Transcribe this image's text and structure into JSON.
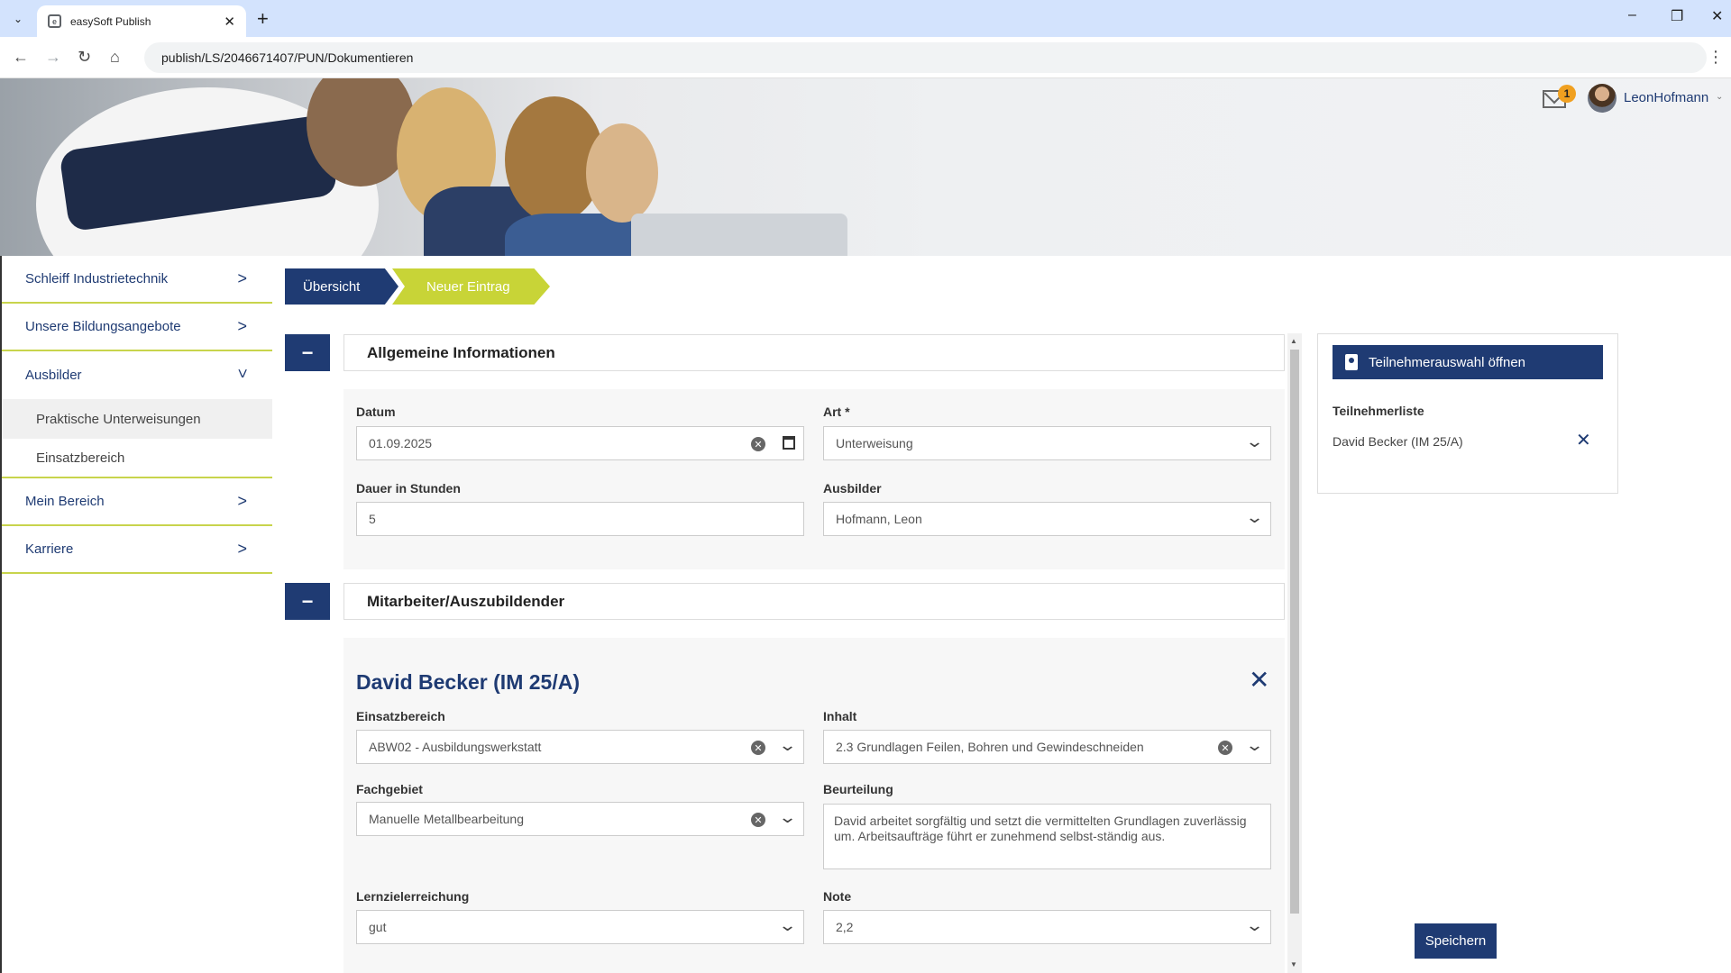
{
  "browser": {
    "tab_title": "easySoft Publish",
    "new_tab": "+",
    "url": "publish/LS/2046671407/PUN/Dokumentieren",
    "window_controls": [
      "–",
      "❐",
      "✕"
    ]
  },
  "header": {
    "notifications_count": "1",
    "user_name": "LeonHofmann"
  },
  "sidebar": {
    "items": [
      {
        "label": "Schleiff Industrietechnik"
      },
      {
        "label": "Unsere Bildungsangebote"
      },
      {
        "label": "Ausbilder"
      },
      {
        "label": "Mein Bereich"
      },
      {
        "label": "Karriere"
      }
    ],
    "sub_items": [
      {
        "label": "Praktische Unterweisungen"
      },
      {
        "label": "Einsatzbereich"
      }
    ]
  },
  "steps": {
    "step1": "Übersicht",
    "step2": "Neuer Eintrag"
  },
  "general": {
    "title": "Allgemeine Informationen",
    "collapse_label": "−",
    "datum_label": "Datum",
    "datum_value": "01.09.2025",
    "art_label": "Art *",
    "art_value": "Unterweisung",
    "dauer_label": "Dauer in Stunden",
    "dauer_value": "5",
    "ausbilder_label": "Ausbilder",
    "ausbilder_value": "Hofmann, Leon"
  },
  "employee": {
    "title": "Mitarbeiter/Auszubildender",
    "collapse_label": "−",
    "person_name": "David Becker (IM 25/A)",
    "einsatz_label": "Einsatzbereich",
    "einsatz_value": "ABW02 - Ausbildungswerkstatt",
    "inhalt_label": "Inhalt",
    "inhalt_value": "2.3 Grundlagen Feilen, Bohren und Gewindeschneiden",
    "fachgebiet_label": "Fachgebiet",
    "fachgebiet_value": "Manuelle Metallbearbeitung",
    "beurteilung_label": "Beurteilung",
    "beurteilung_value": "David arbeitet sorgfältig und setzt die vermittelten Grundlagen zuverlässig um. Arbeitsaufträge führt er zunehmend selbst-ständig aus.",
    "lernziel_label": "Lernzielerreichung",
    "lernziel_value": "gut",
    "note_label": "Note",
    "note_value": "2,2"
  },
  "participants": {
    "open_button": "Teilnehmerauswahl öffnen",
    "list_title": "Teilnehmerliste",
    "entries": [
      {
        "name": "David Becker (IM 25/A)"
      }
    ]
  },
  "actions": {
    "save": "Speichern"
  },
  "colors": {
    "primary": "#1f3b73",
    "accent": "#c8d437",
    "badge": "#f0a020"
  }
}
